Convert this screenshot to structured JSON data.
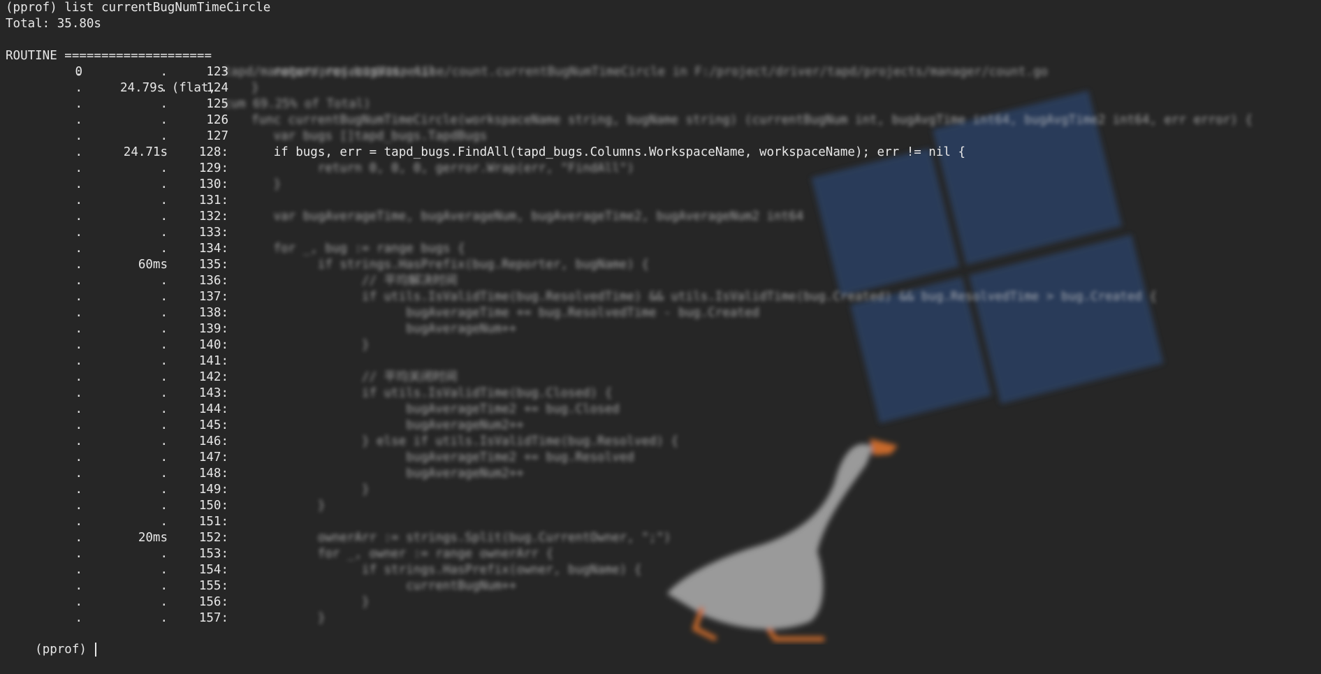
{
  "terminal": {
    "command_line": "(pprof) list currentBugNumTimeCircle",
    "total_line": "Total: 35.80s",
    "routine_prefix": "ROUTINE ====================",
    "routine_rest": "tapd/manager/projects/timeline/count.currentBugNumTimeCircle in F:/project/driver/tapd/projects/manager/count.go",
    "header": {
      "flat": "0",
      "cum": "24.79s (flat,",
      "rest": "cum 69.25% of Total)"
    },
    "rows": [
      {
        "flat": ".",
        "cum": ".",
        "ln": "123",
        "code": "   return res.bugNum, nil",
        "blur": true
      },
      {
        "flat": ".",
        "cum": ".",
        "ln": "124",
        "code": "}",
        "blur": true
      },
      {
        "flat": ".",
        "cum": ".",
        "ln": "125",
        "code": "",
        "blur": true
      },
      {
        "flat": ".",
        "cum": ".",
        "ln": "126",
        "code": "func currentBugNumTimeCircle(workspaceName string, bugName string) (currentBugNum int, bugAvgTime int64, bugAvgTime2 int64, err error) {",
        "blur": true
      },
      {
        "flat": ".",
        "cum": ".",
        "ln": "127",
        "code": "   var bugs []tapd_bugs.TapdBugs",
        "blur": true
      },
      {
        "flat": ".",
        "cum": "24.71s",
        "ln": "128:",
        "code": "   if bugs, err = tapd_bugs.FindAll(tapd_bugs.Columns.WorkspaceName, workspaceName); err != nil {",
        "blur": false
      },
      {
        "flat": ".",
        "cum": ".",
        "ln": "129:",
        "code": "         return 0, 0, 0, gerror.Wrap(err, \"FindAll\")",
        "blur": true
      },
      {
        "flat": ".",
        "cum": ".",
        "ln": "130:",
        "code": "   }",
        "blur": true
      },
      {
        "flat": ".",
        "cum": ".",
        "ln": "131:",
        "code": "",
        "blur": true
      },
      {
        "flat": ".",
        "cum": ".",
        "ln": "132:",
        "code": "   var bugAverageTime, bugAverageNum, bugAverageTime2, bugAverageNum2 int64",
        "blur": true
      },
      {
        "flat": ".",
        "cum": ".",
        "ln": "133:",
        "code": "",
        "blur": true
      },
      {
        "flat": ".",
        "cum": ".",
        "ln": "134:",
        "code": "   for _, bug := range bugs {",
        "blur": true
      },
      {
        "flat": ".",
        "cum": "60ms",
        "ln": "135:",
        "code": "         if strings.HasPrefix(bug.Reporter, bugName) {",
        "blur": true
      },
      {
        "flat": ".",
        "cum": ".",
        "ln": "136:",
        "code": "               // 平均解决时间",
        "blur": true
      },
      {
        "flat": ".",
        "cum": ".",
        "ln": "137:",
        "code": "               if utils.IsValidTime(bug.ResolvedTime) && utils.IsValidTime(bug.Created) && bug.ResolvedTime > bug.Created {",
        "blur": true
      },
      {
        "flat": ".",
        "cum": ".",
        "ln": "138:",
        "code": "                     bugAverageTime += bug.ResolvedTime - bug.Created",
        "blur": true
      },
      {
        "flat": ".",
        "cum": ".",
        "ln": "139:",
        "code": "                     bugAverageNum++",
        "blur": true
      },
      {
        "flat": ".",
        "cum": ".",
        "ln": "140:",
        "code": "               }",
        "blur": true
      },
      {
        "flat": ".",
        "cum": ".",
        "ln": "141:",
        "code": "",
        "blur": true
      },
      {
        "flat": ".",
        "cum": ".",
        "ln": "142:",
        "code": "               // 平均关闭时间",
        "blur": true
      },
      {
        "flat": ".",
        "cum": ".",
        "ln": "143:",
        "code": "               if utils.IsValidTime(bug.Closed) {",
        "blur": true
      },
      {
        "flat": ".",
        "cum": ".",
        "ln": "144:",
        "code": "                     bugAverageTime2 += bug.Closed",
        "blur": true
      },
      {
        "flat": ".",
        "cum": ".",
        "ln": "145:",
        "code": "                     bugAverageNum2++",
        "blur": true
      },
      {
        "flat": ".",
        "cum": ".",
        "ln": "146:",
        "code": "               } else if utils.IsValidTime(bug.Resolved) {",
        "blur": true
      },
      {
        "flat": ".",
        "cum": ".",
        "ln": "147:",
        "code": "                     bugAverageTime2 += bug.Resolved",
        "blur": true
      },
      {
        "flat": ".",
        "cum": ".",
        "ln": "148:",
        "code": "                     bugAverageNum2++",
        "blur": true
      },
      {
        "flat": ".",
        "cum": ".",
        "ln": "149:",
        "code": "               }",
        "blur": true
      },
      {
        "flat": ".",
        "cum": ".",
        "ln": "150:",
        "code": "         }",
        "blur": true
      },
      {
        "flat": ".",
        "cum": ".",
        "ln": "151:",
        "code": "",
        "blur": true
      },
      {
        "flat": ".",
        "cum": "20ms",
        "ln": "152:",
        "code": "         ownerArr := strings.Split(bug.CurrentOwner, \";\")",
        "blur": true
      },
      {
        "flat": ".",
        "cum": ".",
        "ln": "153:",
        "code": "         for _, owner := range ownerArr {",
        "blur": true
      },
      {
        "flat": ".",
        "cum": ".",
        "ln": "154:",
        "code": "               if strings.HasPrefix(owner, bugName) {",
        "blur": true
      },
      {
        "flat": ".",
        "cum": ".",
        "ln": "155:",
        "code": "                     currentBugNum++",
        "blur": true
      },
      {
        "flat": ".",
        "cum": ".",
        "ln": "156:",
        "code": "               }",
        "blur": true
      },
      {
        "flat": ".",
        "cum": ".",
        "ln": "157:",
        "code": "         }",
        "blur": true
      }
    ],
    "prompt": "(pprof)"
  },
  "colors": {
    "background": "#262626",
    "text": "#e8e8e8",
    "window_tile": "#2c3e5c",
    "goose_body": "#9a9a9a",
    "goose_beak": "#c8692a"
  },
  "wallpaper": {
    "icons": [
      "windows-logo-icon",
      "goose-icon"
    ]
  }
}
